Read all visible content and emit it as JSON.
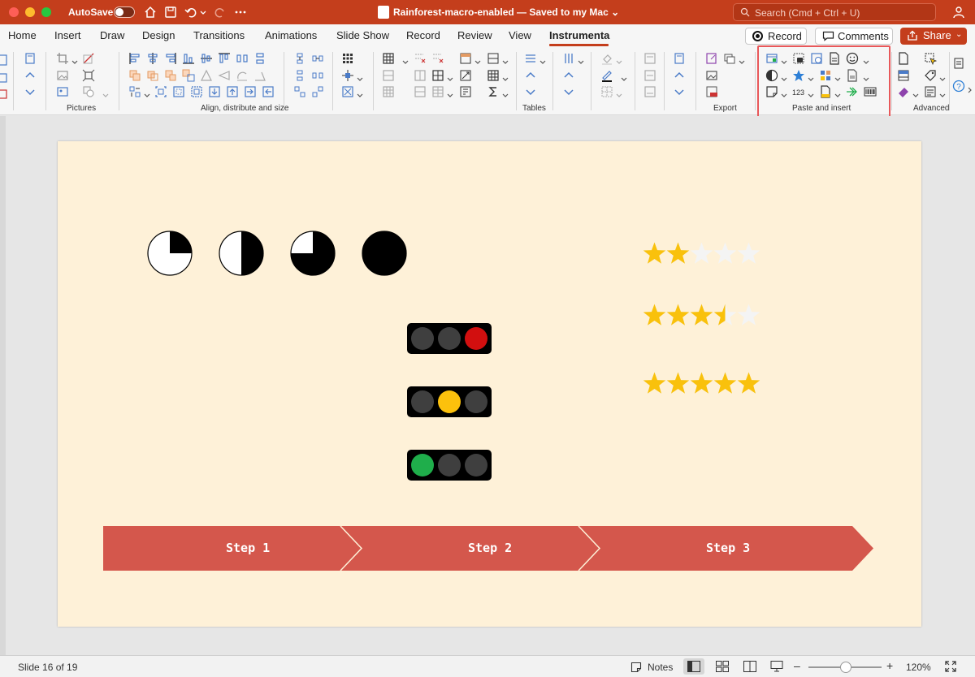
{
  "window": {
    "autosave_label": "AutoSave",
    "title": "Rainforest-macro-enabled — Saved to my Mac ⌄",
    "search_placeholder": "Search (Cmd + Ctrl + U)"
  },
  "menu": {
    "tabs": [
      "Home",
      "Insert",
      "Draw",
      "Design",
      "Transitions",
      "Animations",
      "Slide Show",
      "Record",
      "Review",
      "View",
      "Instrumenta"
    ],
    "active_tab": "Instrumenta",
    "record_label": "Record",
    "comments_label": "Comments",
    "share_label": "Share"
  },
  "ribbon": {
    "groups": [
      "Pictures",
      "Align, distribute and size",
      "Tables",
      "Export",
      "Paste and insert",
      "Advanced"
    ],
    "highlighted_group": "Paste and insert",
    "highlight_color": "#e8585a"
  },
  "slide": {
    "background": "#fef1d8",
    "pies": [
      0.25,
      0.5,
      0.75,
      1.0
    ],
    "traffic_lights": [
      {
        "lit": 2,
        "color": "#d20f0f"
      },
      {
        "lit": 1,
        "color": "#fcc10c"
      },
      {
        "lit": 0,
        "color": "#1fae4b"
      }
    ],
    "ratings": [
      {
        "value": 2,
        "max": 5
      },
      {
        "value": 3.5,
        "max": 5
      },
      {
        "value": 5,
        "max": 5
      }
    ],
    "star_color": "#f9c10c",
    "process_color": "#d4574c",
    "steps": [
      "Step 1",
      "Step 2",
      "Step 3"
    ]
  },
  "status": {
    "slide_counter": "Slide 16 of 19",
    "notes_label": "Notes",
    "zoom_level": "120%"
  }
}
